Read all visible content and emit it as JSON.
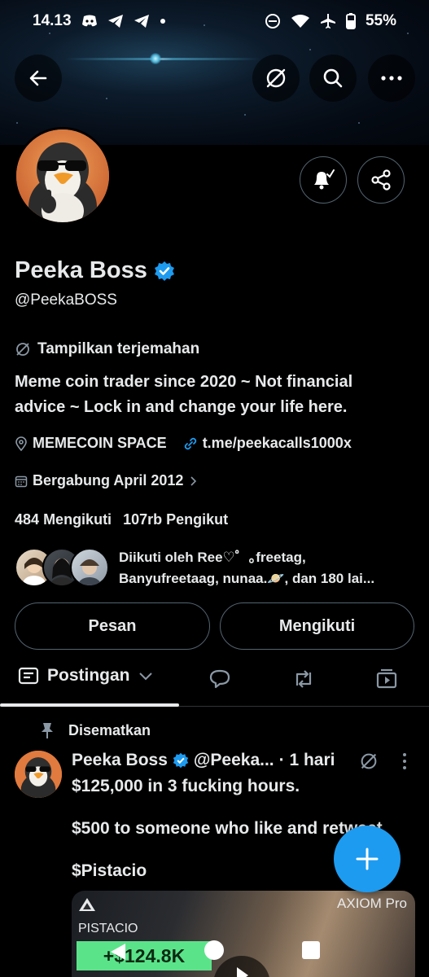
{
  "status_bar": {
    "time": "14.13",
    "battery": "55%"
  },
  "profile": {
    "display_name": "Peeka Boss",
    "handle": "@PeekaBOSS",
    "translate_label": "Tampilkan terjemahan",
    "bio_line1": "Meme coin trader since 2020 ~ Not financial",
    "bio_line2": "advice ~ Lock in and change your life here.",
    "location": "MEMECOIN SPACE",
    "website": "t.me/peekacalls1000x",
    "joined": "Bergabung April 2012",
    "following_count": "484",
    "following_label": "Mengikuti",
    "followers_count": "107rb",
    "followers_label": "Pengikut",
    "followed_by_line1": "Diikuti oleh Ree♡゜｡freetag,",
    "followed_by_line2": "Banyufreetaag, nunaa.🪐, dan 180 lai..."
  },
  "actions": {
    "message_label": "Pesan",
    "following_button_label": "Mengikuti"
  },
  "tabs": {
    "active_label": "Postingan"
  },
  "post": {
    "pinned_label": "Disematkan",
    "author_name": "Peeka Boss",
    "author_handle": "@Peeka...",
    "time": "· 1 hari",
    "line1": "$125,000 in 3 fucking hours.",
    "line2": "$500 to someone who like and retweet",
    "line3": "$Pistacio",
    "media_brand": "AXIOM Pro",
    "media_token": "PISTACIO",
    "media_pnl": "+$124.8K"
  },
  "colors": {
    "accent": "#1d9bf0",
    "background": "#000000",
    "text": "#e7e9ea",
    "border": "#536471",
    "pnl_green": "#5be38a"
  }
}
